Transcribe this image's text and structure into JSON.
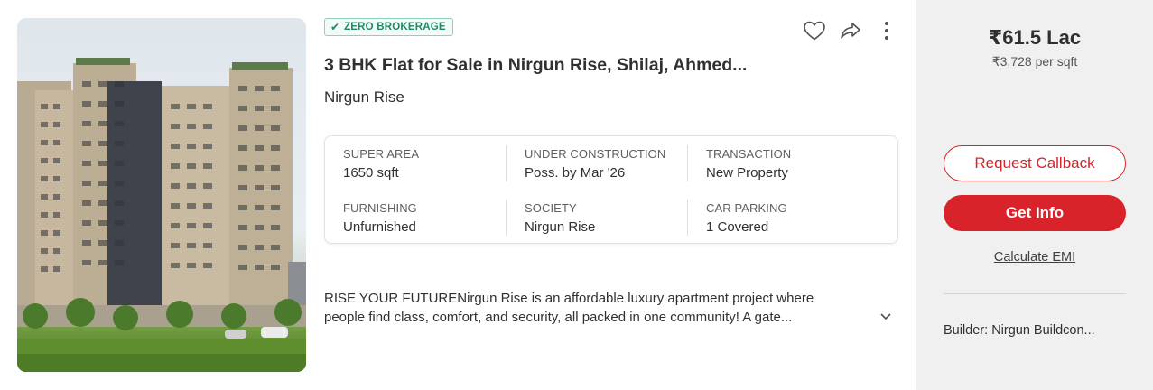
{
  "listing": {
    "badge": {
      "icon": "check-icon",
      "label": "ZERO BROKERAGE"
    },
    "title": "3 BHK Flat for Sale in Nirgun Rise, Shilaj, Ahmed...",
    "society_name": "Nirgun Rise",
    "actions": {
      "favorite_icon": "heart-icon",
      "share_icon": "share-icon",
      "more_icon": "more-vertical-icon"
    },
    "details": [
      {
        "label": "SUPER AREA",
        "value": "1650 sqft"
      },
      {
        "label": "UNDER CONSTRUCTION",
        "value": "Poss. by Mar '26"
      },
      {
        "label": "TRANSACTION",
        "value": "New Property"
      },
      {
        "label": "FURNISHING",
        "value": "Unfurnished"
      },
      {
        "label": "SOCIETY",
        "value": "Nirgun Rise"
      },
      {
        "label": "CAR PARKING",
        "value": "1 Covered"
      }
    ],
    "description": {
      "line1": "RISE YOUR FUTURENirgun Rise is an affordable luxury apartment project where",
      "line2": "people find class, comfort, and security, all packed in one community! A gate...",
      "expand_icon": "chevron-down-icon"
    }
  },
  "pricing": {
    "price": "₹61.5 Lac",
    "per_sqft": "₹3,728 per sqft"
  },
  "cta": {
    "request_callback": "Request Callback",
    "get_info": "Get Info",
    "calculate_emi": "Calculate EMI"
  },
  "builder": "Builder: Nirgun Buildcon...",
  "colors": {
    "accent": "#d8232a",
    "badge_green": "#1d8a64",
    "panel_bg": "#f0f0f0"
  }
}
